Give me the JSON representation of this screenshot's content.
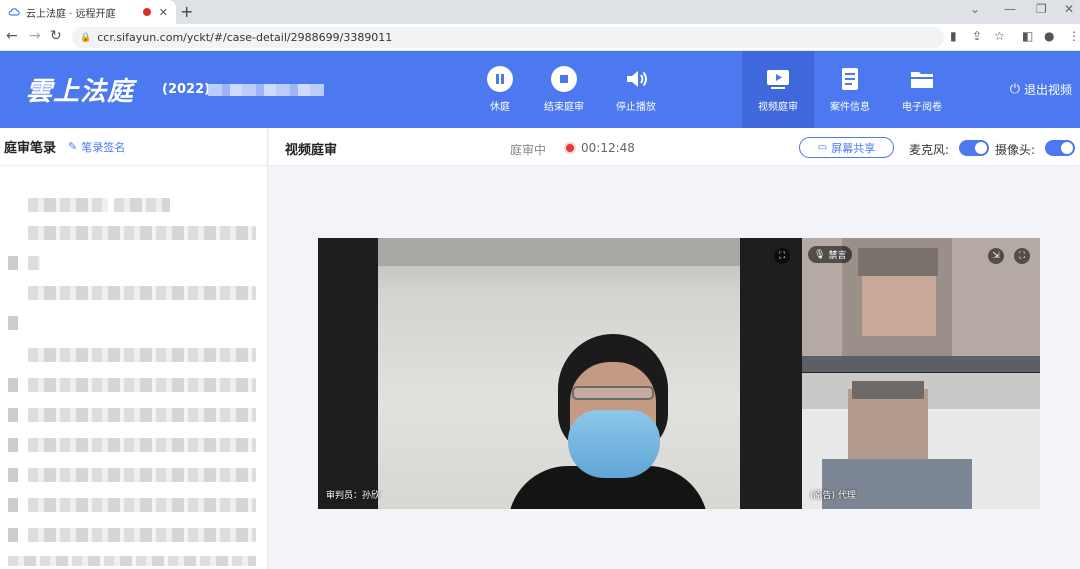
{
  "browser": {
    "tab_title": "云上法庭 · 远程开庭",
    "tab_close": "✕",
    "new_tab": "+",
    "url": "ccr.sifayun.com/yckt/#/case-detail/2988699/3389011"
  },
  "header": {
    "logo": "雲上法庭",
    "case_number": "(2022)",
    "buttons": [
      {
        "label": "休庭",
        "icon": "pause-icon"
      },
      {
        "label": "结束庭审",
        "icon": "stop-icon"
      },
      {
        "label": "停止播放",
        "icon": "speaker-icon"
      },
      {
        "label": "视频庭审",
        "icon": "video-play-icon",
        "active": true
      },
      {
        "label": "案件信息",
        "icon": "document-icon"
      },
      {
        "label": "电子阅卷",
        "icon": "folder-icon"
      }
    ],
    "exit_label": "退出视频",
    "colors": {
      "header_bg": "#4c78f0",
      "active_bg": "#3f68dc"
    }
  },
  "left_panel": {
    "title": "庭审笔录",
    "sign_label": "笔录签名"
  },
  "main": {
    "title": "视频庭审",
    "status": "庭审中",
    "timer": "00:12:48",
    "share_label": "屏幕共享",
    "mic_label": "麦克风:",
    "camera_label": "摄像头:",
    "mic_on": true,
    "camera_on": true
  },
  "videos": {
    "main_label": "审判员：孙欣",
    "side_top_badge": "禁言",
    "side_bottom_label": "(原告) 代理"
  }
}
